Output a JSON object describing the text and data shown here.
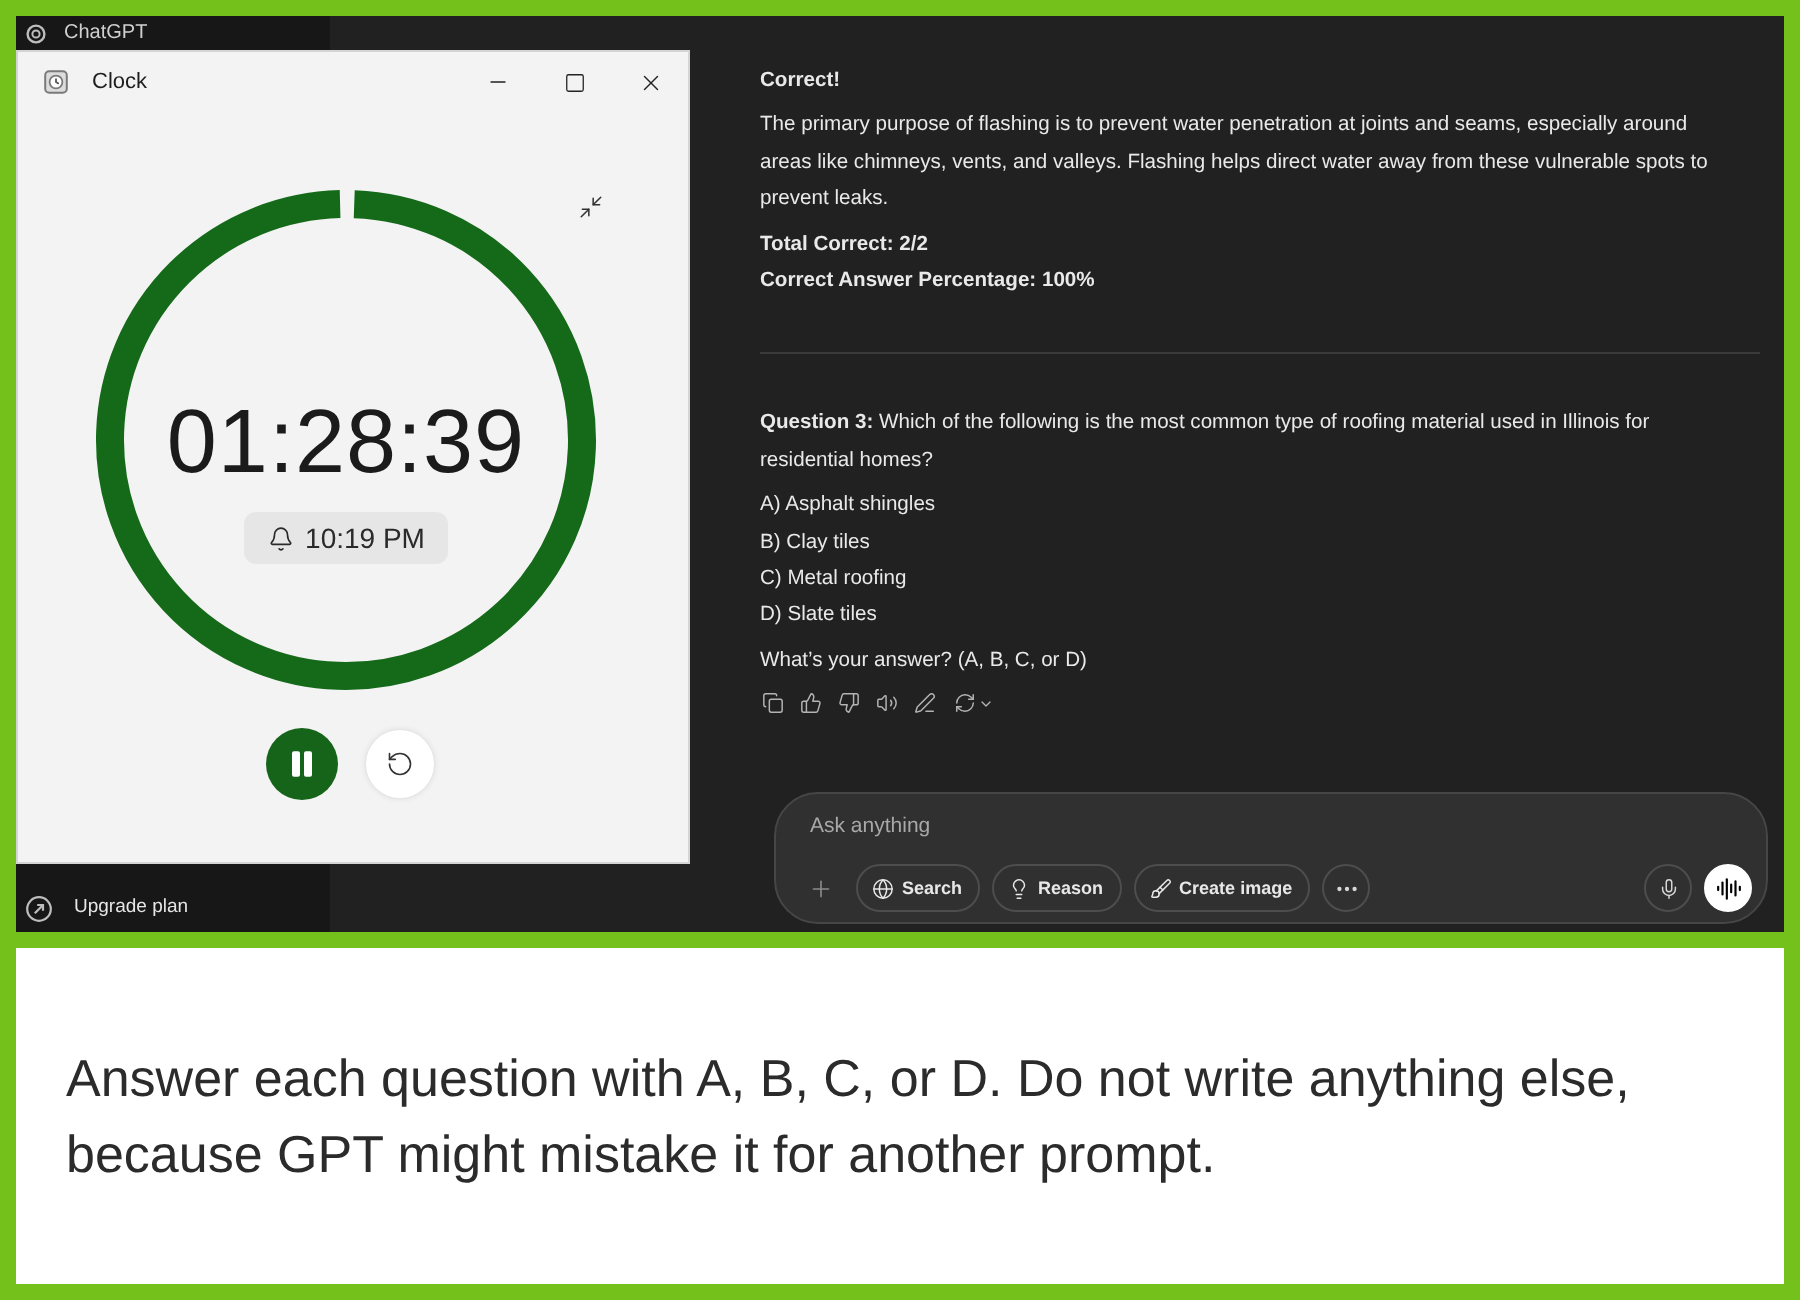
{
  "app_bar": {
    "title": "ChatGPT"
  },
  "clock_window": {
    "title": "Clock",
    "timer": {
      "time": "01:28:39",
      "level": 0.99,
      "running": true,
      "alarm": "10:19 PM"
    }
  },
  "sidebar": {
    "upgrade": {
      "label": "Upgrade plan"
    }
  },
  "chat": {
    "feedback": {
      "title": "Correct!",
      "explanation": "The primary purpose of flashing is to prevent water penetration at joints and seams, especially around areas like chimneys, vents, and valleys. Flashing helps direct water away from these vulnerable spots to prevent leaks.",
      "stats": [
        "Total Correct: 2/2",
        "Correct Answer Percentage: 100%"
      ]
    },
    "question": {
      "prompt": "**Question 3:** Which of the following is the most common type of roofing material used in Illinois for residential homes?",
      "options": [
        "A) Asphalt shingles",
        "B) Clay tiles",
        "C) Metal roofing",
        "D) Slate tiles"
      ],
      "ask": "What’s your answer? (A, B, C, or D)"
    }
  },
  "composer": {
    "placeholder": "Ask anything",
    "tools": [
      {
        "label": "Search"
      },
      {
        "label": "Reason"
      },
      {
        "label": "Create image"
      }
    ]
  },
  "caption": {
    "text": "Answer each question with A, B, C, or D. Do not write anything else, because GPT might mistake it for another prompt."
  }
}
